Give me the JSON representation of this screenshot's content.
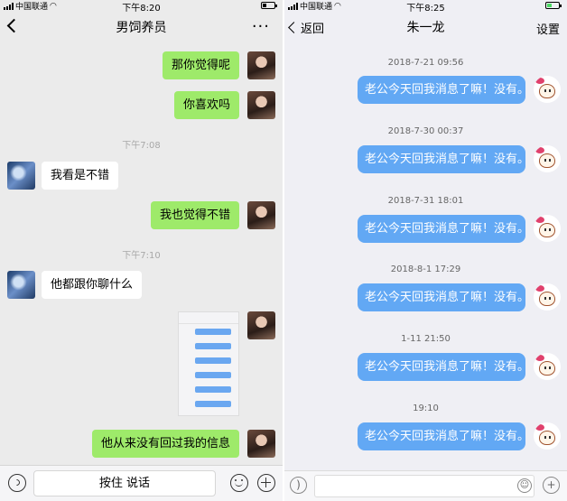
{
  "left": {
    "status": {
      "carrier": "中国联通",
      "time": "下午8:20"
    },
    "title": "男饲养员",
    "more_glyph": "···",
    "messages": [
      {
        "side": "right",
        "text": "那你觉得呢"
      },
      {
        "side": "right",
        "text": "你喜欢吗"
      },
      {
        "side": "left",
        "text": "我看是不错"
      },
      {
        "side": "right",
        "text": "我也觉得不错"
      },
      {
        "side": "left",
        "text": "他都跟你聊什么"
      },
      {
        "side": "right",
        "text": "他从来没有回过我的信息"
      }
    ],
    "timestamps": [
      "下午7:08",
      "下午7:10"
    ],
    "hold_to_talk": "按住 说话"
  },
  "right": {
    "status": {
      "carrier": "中国联通",
      "time": "下午8:25"
    },
    "back_label": "返回",
    "title": "朱一龙",
    "settings_label": "设置",
    "messages": [
      {
        "time": "2018-7-21 09:56",
        "text": "老公今天回我消息了嘛！没有。"
      },
      {
        "time": "2018-7-30 00:37",
        "text": "老公今天回我消息了嘛！没有。"
      },
      {
        "time": "2018-7-31 18:01",
        "text": "老公今天回我消息了嘛！没有。"
      },
      {
        "time": "2018-8-1 17:29",
        "text": "老公今天回我消息了嘛！没有。"
      },
      {
        "time": "1-11 21:50",
        "text": "老公今天回我消息了嘛！没有。"
      },
      {
        "time": "19:10",
        "text": "老公今天回我消息了嘛！没有。"
      }
    ]
  },
  "colors": {
    "wechat_green": "#9eea6a",
    "qq_blue": "#62a8f4"
  },
  "icons": [
    "back-chevron-icon",
    "more-icon",
    "voice-icon",
    "emoji-icon",
    "add-icon"
  ]
}
